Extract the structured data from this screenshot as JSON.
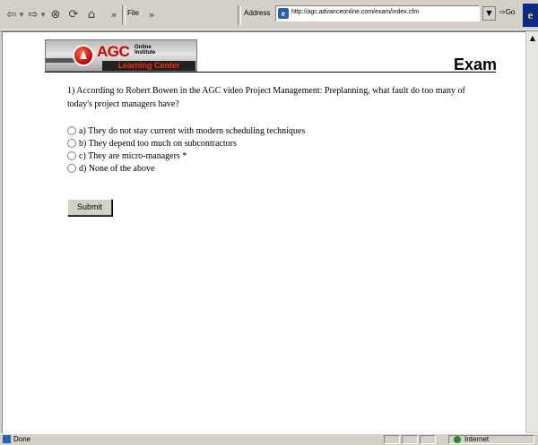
{
  "browser": {
    "nav_back": "⇦",
    "nav_forward": "⇨",
    "stop": "⊗",
    "refresh": "⟳",
    "home": "⌂",
    "chevron": "»",
    "file_menu": "File",
    "address_label": "Address",
    "address_url": "http://agc.advanceonline.com/exam/index.cfm",
    "go_label": "Go",
    "status_text": "Done",
    "zone_text": "Internet"
  },
  "page": {
    "logo_main": "AGC",
    "logo_line1": "Online",
    "logo_line2": "Institute",
    "logo_sub": "Learning Center",
    "heading": "Exam",
    "question": "1)  According to Robert Bowen in the AGC video Project Management: Preplanning, what fault do too many of today's project managers have?",
    "options": [
      {
        "label": "a) They do not stay current with modern scheduling techniques"
      },
      {
        "label": "b) They depend too much on subcontractors"
      },
      {
        "label": "c) They are micro-managers *"
      },
      {
        "label": "d) None of the above"
      }
    ],
    "submit_label": "Submit"
  },
  "colors": {
    "chrome": "#d4d0c8",
    "logo_red": "#d40000"
  },
  "icons": [
    "back-arrow-icon",
    "forward-arrow-icon",
    "stop-icon",
    "refresh-icon",
    "home-icon",
    "page-icon",
    "ie-logo-icon",
    "globe-icon"
  ]
}
